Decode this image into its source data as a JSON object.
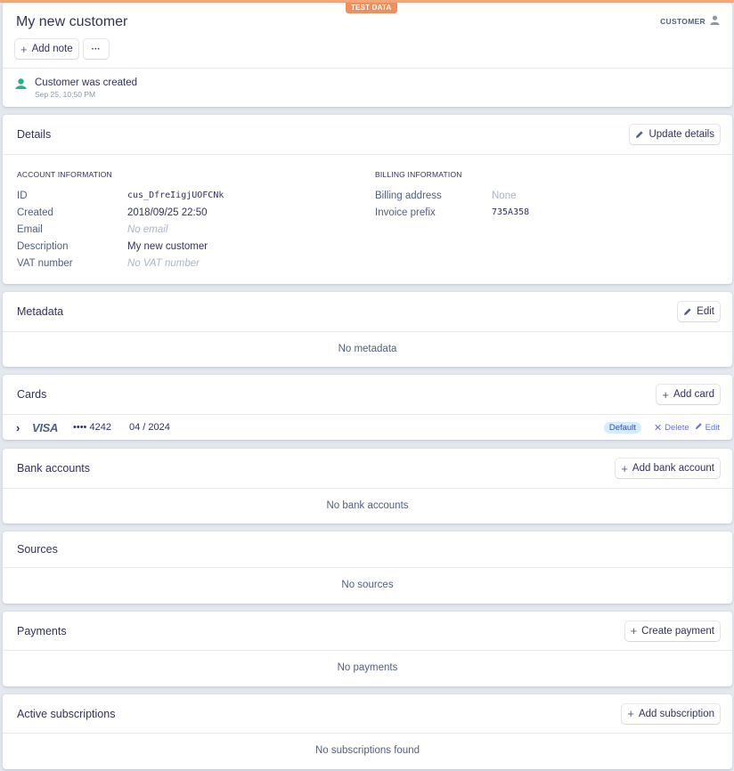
{
  "environment_badge": "TEST DATA",
  "customer": {
    "name": "My new customer",
    "type_label": "CUSTOMER",
    "add_note_label": "Add note",
    "more_label": "···",
    "event": {
      "text": "Customer was created",
      "time": "Sep 25, 10:50 PM"
    }
  },
  "details": {
    "title": "Details",
    "update_label": "Update details",
    "account": {
      "heading": "ACCOUNT INFORMATION",
      "rows": [
        {
          "label": "ID",
          "value": "cus_DfreIigjUOFCNk"
        },
        {
          "label": "Created",
          "value": "2018/09/25 22:50"
        },
        {
          "label": "Email",
          "value": "No email"
        },
        {
          "label": "Description",
          "value": "My new customer"
        },
        {
          "label": "VAT number",
          "value": "No VAT number"
        }
      ]
    },
    "billing": {
      "heading": "BILLING INFORMATION",
      "rows": [
        {
          "label": "Billing address",
          "value": "None"
        },
        {
          "label": "Invoice prefix",
          "value": "735A358"
        }
      ]
    }
  },
  "metadata": {
    "title": "Metadata",
    "edit_label": "Edit",
    "empty": "No metadata"
  },
  "cards": {
    "title": "Cards",
    "add_label": "Add card",
    "items": [
      {
        "brand": "VISA",
        "last4": "•••• 4242",
        "expiry": "04 / 2024",
        "badge": "Default",
        "delete_label": "Delete",
        "edit_label": "Edit"
      }
    ]
  },
  "bank_accounts": {
    "title": "Bank accounts",
    "add_label": "Add bank account",
    "empty": "No bank accounts"
  },
  "sources": {
    "title": "Sources",
    "empty": "No sources"
  },
  "payments": {
    "title": "Payments",
    "create_label": "Create payment",
    "empty": "No payments"
  },
  "subscriptions": {
    "title": "Active subscriptions",
    "add_label": "Add subscription",
    "empty": "No subscriptions found"
  },
  "colors": {
    "accent": "#6772e5",
    "test_badge": "#f08f5c",
    "success": "#24b47e"
  }
}
